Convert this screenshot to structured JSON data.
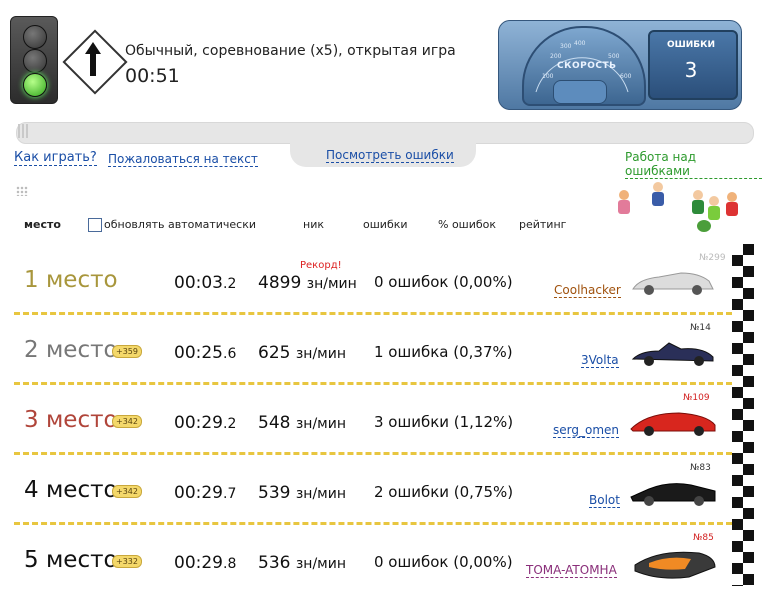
{
  "game": {
    "type_text": "Обычный, соревнование (х5), открытая игра",
    "timer": "00:51"
  },
  "dashboard": {
    "speed_label": "СКОРОСТЬ",
    "speed_ticks": [
      "100",
      "200",
      "300",
      "400",
      "500",
      "600"
    ],
    "errors_label": "ОШИБКИ",
    "errors_value": "3"
  },
  "links": {
    "how_to_play": "Как играть?",
    "complain": "Пожаловаться на текст",
    "view_errors": "Посмотреть ошибки",
    "work_on_errors": "Работа над ошибками"
  },
  "table_header": {
    "place": "место",
    "auto_update": "обновлять автоматически",
    "nick": "ник",
    "errors": "ошибки",
    "error_percent": "% ошибок",
    "rating": "рейтинг"
  },
  "colors": {
    "link": "#1a4ea6",
    "green_link": "#2d9a2d",
    "separator": "#e8c640",
    "record": "#d22222"
  },
  "results": [
    {
      "place": "1 место",
      "place_color": "#a8963c",
      "bonus": "",
      "time_main": "00:03",
      "time_frac": ".2",
      "speed": "4899",
      "speed_unit": "зн/мин",
      "record": "Рекорд!",
      "errors_text": "0 ошибок (0,00%)",
      "nick": "Coolhacker",
      "nick_color": "#a0520e",
      "rank": "№299",
      "rank_color": "#bbbbbb",
      "car": "silver-coupe-icon"
    },
    {
      "place": "2 место",
      "place_color": "#777777",
      "bonus": "+359",
      "time_main": "00:25",
      "time_frac": ".6",
      "speed": "625",
      "speed_unit": "зн/мин",
      "record": "",
      "errors_text": "1 ошибка (0,37%)",
      "nick": "3Volta",
      "nick_color": "#1a4ea6",
      "rank": "№14",
      "rank_color": "#333333",
      "car": "navy-roadster-icon"
    },
    {
      "place": "3 место",
      "place_color": "#b0453a",
      "bonus": "+342",
      "time_main": "00:29",
      "time_frac": ".2",
      "speed": "548",
      "speed_unit": "зн/мин",
      "record": "",
      "errors_text": "3 ошибки (1,12%)",
      "nick": "serg_omen",
      "nick_color": "#1a4ea6",
      "rank": "№109",
      "rank_color": "#d22222",
      "car": "red-concept-car-icon"
    },
    {
      "place": "4 место",
      "place_color": "#111111",
      "bonus": "+342",
      "time_main": "00:29",
      "time_frac": ".7",
      "speed": "539",
      "speed_unit": "зн/мин",
      "record": "",
      "errors_text": "2 ошибки (0,75%)",
      "nick": "Bolot",
      "nick_color": "#1a4ea6",
      "rank": "№83",
      "rank_color": "#333333",
      "car": "black-batmobile-icon"
    },
    {
      "place": "5 место",
      "place_color": "#111111",
      "bonus": "+332",
      "time_main": "00:29",
      "time_frac": ".8",
      "speed": "536",
      "speed_unit": "зн/мин",
      "record": "",
      "errors_text": "0 ошибок (0,00%)",
      "nick": "TOMA-ATOMHA",
      "nick_color": "#8a2f7a",
      "rank": "№85",
      "rank_color": "#d22222",
      "car": "hover-flame-car-icon"
    }
  ]
}
